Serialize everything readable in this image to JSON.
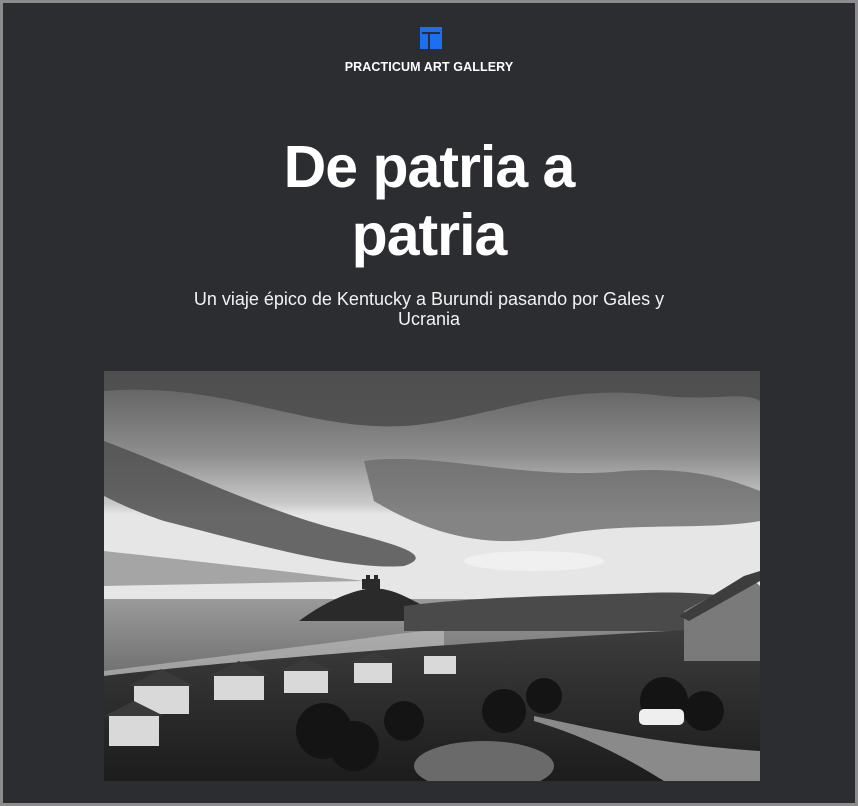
{
  "header": {
    "logo_icon": "gallery-logo-icon",
    "brand_name": "PRACTICUM ART GALLERY",
    "accent_color": "#1d6ff2"
  },
  "hero": {
    "title": "De patria a patria",
    "subtitle": "Un viaje épico de Kentucky a Burundi pasando por Gales y Ucrania"
  },
  "photo": {
    "description_icon": "black-and-white-coastal-town-photo"
  }
}
